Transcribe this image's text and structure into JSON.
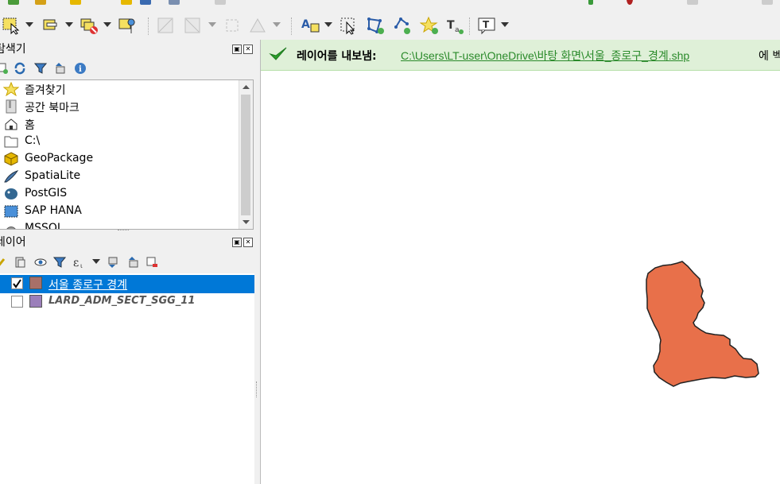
{
  "browser_panel": {
    "title": "탐색기",
    "items": [
      {
        "label": "즐겨찾기",
        "icon": "star-icon"
      },
      {
        "label": "공간 북마크",
        "icon": "bookmark-icon"
      },
      {
        "label": "홈",
        "icon": "home-icon"
      },
      {
        "label": "C:\\",
        "icon": "folder-icon"
      },
      {
        "label": "GeoPackage",
        "icon": "geopackage-icon"
      },
      {
        "label": "SpatiaLite",
        "icon": "spatialite-icon"
      },
      {
        "label": "PostGIS",
        "icon": "postgis-icon"
      },
      {
        "label": "SAP HANA",
        "icon": "sap-hana-icon"
      },
      {
        "label": "MSSQL",
        "icon": "mssql-icon"
      }
    ]
  },
  "layers_panel": {
    "title": "레이어",
    "layers": [
      {
        "name": "서울 종로구 경계",
        "checked": true,
        "selected": true,
        "color": "#a87068"
      },
      {
        "name": "LARD_ADM_SECT_SGG_11",
        "checked": false,
        "selected": false,
        "color": "#9b7fba"
      }
    ]
  },
  "message_bar": {
    "label": "레이어를 내보냄:",
    "link": "C:\\Users\\LT-user\\OneDrive\\바탕 화면\\서울_종로구_경계.shp",
    "suffix": "에 벡"
  },
  "map": {
    "feature_color": "#e8704a",
    "feature_stroke": "#222222"
  },
  "colors": {
    "selection": "#0078d7",
    "message_green": "#2a9d2a"
  }
}
